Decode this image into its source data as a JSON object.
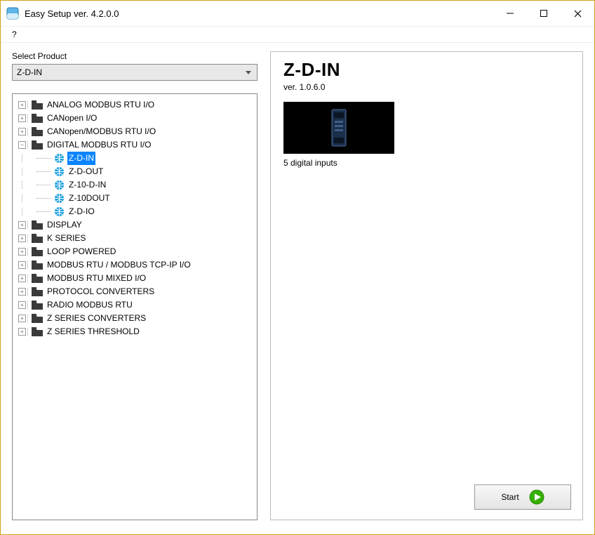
{
  "window": {
    "title": "Easy Setup ver. 4.2.0.0"
  },
  "menu": {
    "help": "?"
  },
  "left": {
    "select_label": "Select Product",
    "selected": "Z-D-IN",
    "tree": {
      "analog": "ANALOG MODBUS RTU I/O",
      "canopen": "CANopen I/O",
      "canmod": "CANopen/MODBUS RTU I/O",
      "digital": "DIGITAL MODBUS RTU I/O",
      "digital_children": {
        "zdin": "Z-D-IN",
        "zdout": "Z-D-OUT",
        "z10din": "Z-10-D-IN",
        "z10dout": "Z-10DOUT",
        "zdio": "Z-D-IO"
      },
      "display": "DISPLAY",
      "kseries": "K SERIES",
      "loop": "LOOP POWERED",
      "modrtu": "MODBUS RTU / MODBUS TCP-IP I/O",
      "modmixed": "MODBUS RTU MIXED I/O",
      "proto": "PROTOCOL CONVERTERS",
      "radio": "RADIO MODBUS RTU",
      "zconv": "Z SERIES CONVERTERS",
      "zthresh": "Z SERIES THRESHOLD"
    }
  },
  "detail": {
    "title": "Z-D-IN",
    "version": "ver. 1.0.6.0",
    "description": "5 digital inputs"
  },
  "buttons": {
    "start": "Start"
  }
}
